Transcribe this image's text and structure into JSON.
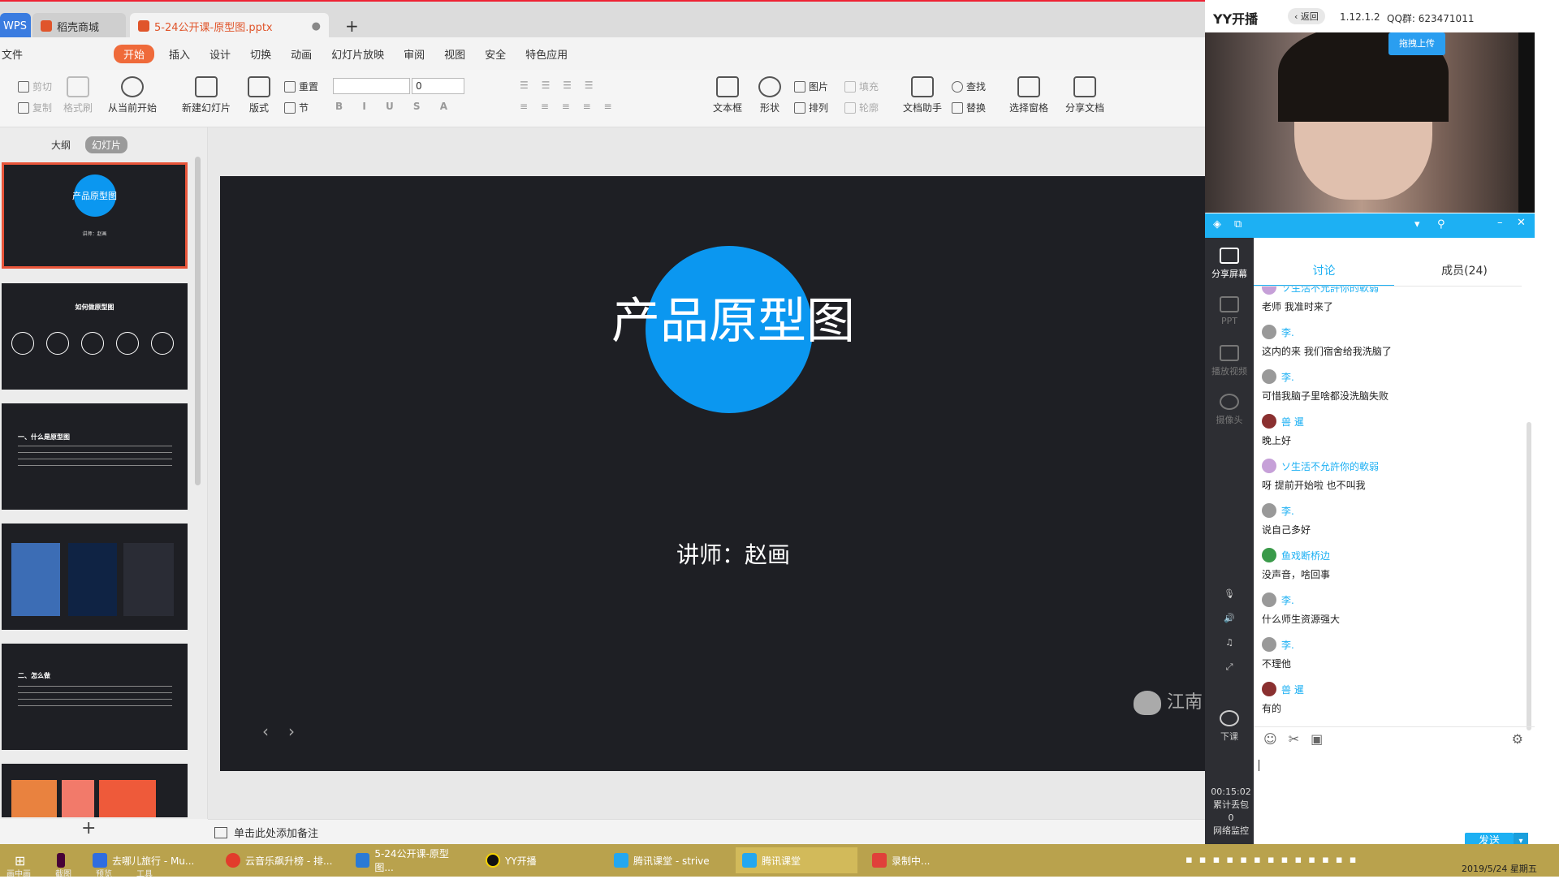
{
  "wps": {
    "tabs": [
      {
        "label": "WPS"
      },
      {
        "label": "稻壳商城"
      },
      {
        "label": "5-24公开课-原型图.pptx"
      }
    ],
    "new_tab": "+",
    "menus": [
      "文件",
      "开始",
      "插入",
      "设计",
      "切换",
      "动画",
      "幻灯片放映",
      "审阅",
      "视图",
      "安全",
      "特色应用"
    ],
    "ribbon": {
      "cut": "剪切",
      "copy": "复制",
      "format_painter": "格式刷",
      "play_from_current": "从当前开始",
      "new_slide": "新建幻灯片",
      "layout": "版式",
      "reset": "重置",
      "section": "节",
      "font_size_value": "0",
      "textbox": "文本框",
      "shape": "形状",
      "picture": "图片",
      "fill": "填充",
      "arrange": "排列",
      "outline": "轮廓",
      "doc_helper": "文档助手",
      "find": "查找",
      "replace": "替换",
      "select_pane": "选择窗格",
      "share_doc": "分享文档"
    },
    "view_switch": {
      "outline": "大纲",
      "slides": "幻灯片"
    },
    "thumbnails": [
      {
        "title": "产品原型图",
        "sub": "讲师：赵画"
      },
      {
        "title": "如何做原型图"
      },
      {
        "title": "一、什么是原型图"
      },
      {
        "title": ""
      },
      {
        "title": "二、怎么做"
      },
      {
        "title": ""
      }
    ],
    "slide": {
      "title": "产品原型图",
      "subtitle": "讲师：赵画",
      "watermark": "江南",
      "prev": "‹",
      "next": "›"
    },
    "notes_placeholder": "单击此处添加备注"
  },
  "yy": {
    "logo": "YY开播",
    "back": "返回",
    "version": "1.12.1.2",
    "qq_group": "QQ群: 623471011",
    "drag_upload": "拖拽上传",
    "rail": {
      "share_screen": "分享屏幕",
      "ppt": "PPT",
      "play_video": "播放视频",
      "camera": "摄像头",
      "end_class": "下课",
      "elapsed": "00:15:02",
      "lost_packets_label": "累计丢包",
      "lost_packets": "0",
      "network": "网络监控"
    },
    "tabs": {
      "discuss": "讨论",
      "members": "成员(24)"
    },
    "messages": [
      {
        "name": "ソ生活不允許你的軟弱",
        "text": "老师  我准时来了"
      },
      {
        "name": "李.",
        "text": "这内的来 我们宿舍给我洗脑了"
      },
      {
        "name": "李.",
        "text": "可惜我脑子里啥都没洗脑失败"
      },
      {
        "name": "兽 暹",
        "text": "晚上好"
      },
      {
        "name": "ソ生活不允許你的軟弱",
        "text": "呀 提前开始啦 也不叫我"
      },
      {
        "name": "李.",
        "text": "说自己多好"
      },
      {
        "name": "鱼戏断桥边",
        "text": "没声音，啥回事"
      },
      {
        "name": "李.",
        "text": "什么师生资源强大"
      },
      {
        "name": "李.",
        "text": "不理他"
      },
      {
        "name": "兽 暹",
        "text": "有的"
      }
    ],
    "send": "发送"
  },
  "taskbar": {
    "items": [
      {
        "label": "去哪儿旅行 - Mu..."
      },
      {
        "label": "云音乐飙升榜 - 排..."
      },
      {
        "label": "5-24公开课-原型图..."
      },
      {
        "label": "YY开播"
      },
      {
        "label": "腾讯课堂 - strive"
      },
      {
        "label": "腾讯课堂"
      },
      {
        "label": "录制中..."
      }
    ],
    "clock": "2019/5/24 星期五",
    "bottom_labels": [
      "画中画",
      "截图",
      "预览",
      "工具"
    ]
  }
}
